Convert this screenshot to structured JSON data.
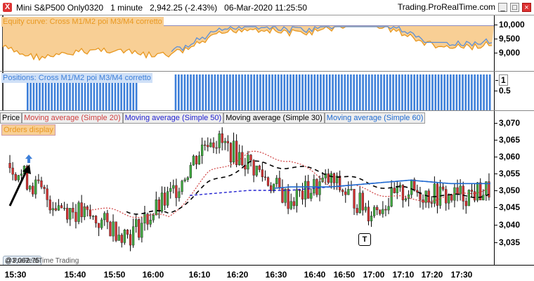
{
  "titlebar": {
    "close_glyph": "X",
    "info": "Mini S&P500 Only0320   1 minute   2,942.25 (-2.43%)   06-Mar-2020 11:25:50",
    "brand": "Trading.ProRealTime.com",
    "min_glyph": "_",
    "max_glyph": "□",
    "close_btn_glyph": "×"
  },
  "equity_panel": {
    "title": "Equity curve: Cross M1/M2 poi M3/M4 corretto",
    "ticks": [
      "10,000",
      "9,500",
      "9,000"
    ],
    "tick_values": [
      10000,
      9500,
      9000
    ],
    "colors": {
      "fill": "#f8cf95",
      "line": "#e89820",
      "top_line": "#5b8fd8",
      "ref_line": "#1a1a80"
    }
  },
  "positions_panel": {
    "title": "Positions: Cross M1/M2 poi M3/M4 corretto",
    "ticks": [
      "1",
      "0.5"
    ],
    "tick_values": [
      1,
      0.5
    ],
    "bar_color": "#3d7fd9"
  },
  "price_panel": {
    "legend": [
      {
        "text": "Price",
        "color": "#000000"
      },
      {
        "text": "Moving average (Simple 20)",
        "color": "#d04040"
      },
      {
        "text": "Moving average (Simple 50)",
        "color": "#2020d0"
      },
      {
        "text": "Moving average (Simple 30)",
        "color": "#000000"
      },
      {
        "text": "Moving average (Simple 60)",
        "color": "#1e6ad0"
      }
    ],
    "orders_label": "Orders display",
    "ticks": [
      "3,070",
      "3,065",
      "3,060",
      "3,055",
      "3,050",
      "3,045",
      "3,040",
      "3,035"
    ],
    "tick_values": [
      3070,
      3065,
      3060,
      3055,
      3050,
      3045,
      3040,
      3035
    ],
    "cursor_value": "@3,062.75",
    "watermark": "© ProRealTime Trading",
    "t_icon": "T",
    "colors": {
      "up": "#3fa83f",
      "down": "#d03030"
    }
  },
  "x_axis": {
    "labels": [
      "15:30",
      "15:40",
      "15:50",
      "16:00",
      "16:10",
      "16:20",
      "16:30",
      "16:40",
      "16:50",
      "17:00",
      "17:10",
      "17:20",
      "17:30"
    ]
  },
  "chart_data": {
    "type": "candlestick",
    "title": "Mini S&P500 Only0320 1 minute",
    "x": [
      "15:30",
      "15:40",
      "15:50",
      "16:00",
      "16:10",
      "16:20",
      "16:30",
      "16:40",
      "16:50",
      "17:00",
      "17:10",
      "17:20",
      "17:30"
    ],
    "close_approx": [
      3058,
      3047,
      3042,
      3037,
      3048,
      3066,
      3058,
      3047,
      3053,
      3044,
      3050,
      3048,
      3050
    ],
    "ylim": [
      3032,
      3072
    ],
    "series": [
      {
        "name": "Moving average (Simple 20)",
        "values": [
          3055,
          3052,
          3045,
          3043,
          3042,
          3055,
          3061,
          3059,
          3052,
          3050,
          3047,
          3048,
          3051
        ]
      },
      {
        "name": "Moving average (Simple 50)",
        "values": [
          3045,
          3046,
          3046,
          3047,
          3048,
          3049,
          3050,
          3050,
          3051,
          3052,
          3053,
          3052,
          3052
        ]
      },
      {
        "name": "Moving average (Simple 30)",
        "values": [
          3050,
          3048,
          3046,
          3044,
          3043,
          3052,
          3058,
          3057,
          3055,
          3052,
          3050,
          3048,
          3049
        ]
      },
      {
        "name": "Moving average (Simple 60)",
        "values": [
          3047,
          3047,
          3048,
          3048,
          3049,
          3049,
          3050,
          3051,
          3051,
          3052,
          3053,
          3052,
          3052
        ]
      }
    ]
  }
}
